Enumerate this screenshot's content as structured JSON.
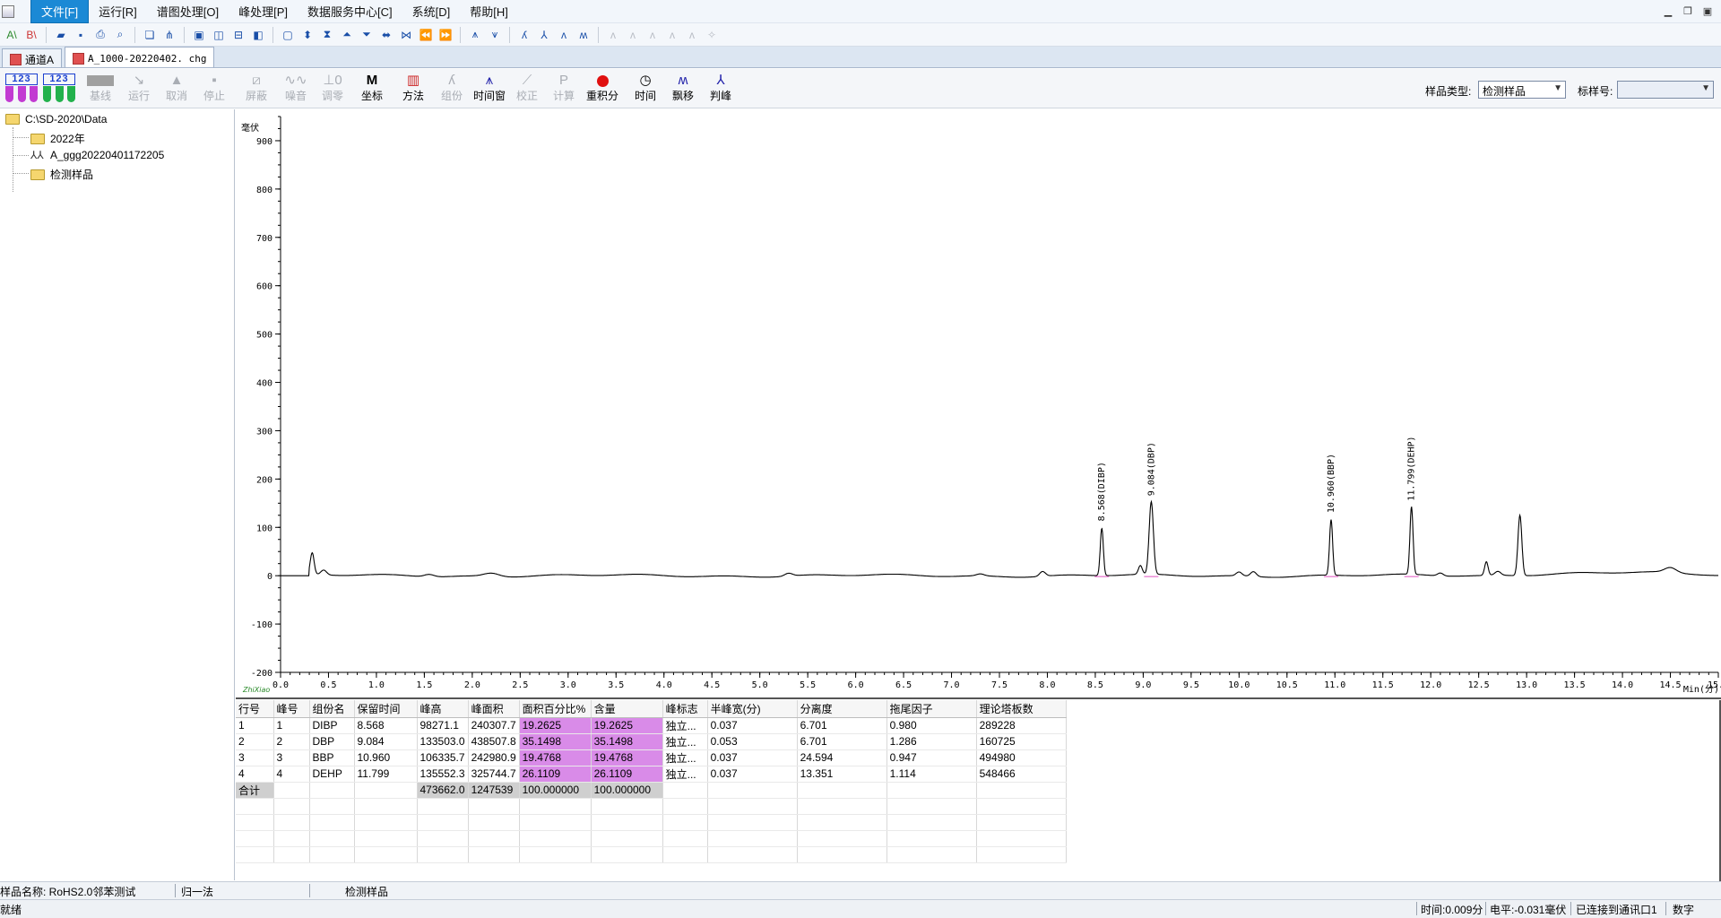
{
  "menu": {
    "items": [
      "文件[F]",
      "运行[R]",
      "谱图处理[O]",
      "峰处理[P]",
      "数据服务中心[C]",
      "系统[D]",
      "帮助[H]"
    ]
  },
  "tabs": [
    {
      "label": "通道A",
      "active": false
    },
    {
      "label": "A_1000-20220402. chg",
      "active": true
    }
  ],
  "toolbar2": {
    "tools": [
      {
        "label": "基线",
        "enabled": false
      },
      {
        "label": "运行",
        "enabled": false
      },
      {
        "label": "取消",
        "enabled": false
      },
      {
        "label": "停止",
        "enabled": false
      },
      {
        "label": "屏蔽",
        "enabled": false
      },
      {
        "label": "噪音",
        "enabled": false
      },
      {
        "label": "调零",
        "enabled": false
      },
      {
        "label": "坐标",
        "enabled": true
      },
      {
        "label": "方法",
        "enabled": true
      },
      {
        "label": "组份",
        "enabled": false
      },
      {
        "label": "时间窗",
        "enabled": true
      },
      {
        "label": "校正",
        "enabled": false
      },
      {
        "label": "计算",
        "enabled": false
      },
      {
        "label": "重积分",
        "enabled": true
      },
      {
        "label": "时间",
        "enabled": true
      },
      {
        "label": "飘移",
        "enabled": true
      },
      {
        "label": "判峰",
        "enabled": true
      }
    ],
    "sample_type_label": "样品类型:",
    "sample_type_value": "检测样品",
    "std_no_label": "标样号:",
    "std_no_value": "",
    "vial_digits": "123"
  },
  "tree": {
    "root": "C:\\SD-2020\\Data",
    "children": [
      "2022年",
      "A_ggg20220401172205",
      "检测样品"
    ]
  },
  "chart_data": {
    "type": "line",
    "ylabel": "毫伏",
    "xlabel": "Min(分)",
    "xlim": [
      0.0,
      15.0
    ],
    "ylim": [
      -200,
      950
    ],
    "x_ticks": [
      "0.0",
      "0.5",
      "1.0",
      "1.5",
      "2.0",
      "2.5",
      "3.0",
      "3.5",
      "4.0",
      "4.5",
      "5.0",
      "5.5",
      "6.0",
      "6.5",
      "7.0",
      "7.5",
      "8.0",
      "8.5",
      "9.0",
      "9.5",
      "10.0",
      "10.5",
      "11.0",
      "11.5",
      "12.0",
      "12.5",
      "13.0",
      "13.5",
      "14.0",
      "14.5",
      "15.0"
    ],
    "y_ticks": [
      "900",
      "800",
      "700",
      "600",
      "500",
      "400",
      "300",
      "200",
      "100",
      "0",
      "-100",
      "-200"
    ],
    "peak_labels": [
      {
        "x": 8.568,
        "text": "8.568(DIBP)"
      },
      {
        "x": 9.084,
        "text": "9.084(DBP)"
      },
      {
        "x": 10.96,
        "text": "10.960(BBP)"
      },
      {
        "x": 11.799,
        "text": "11.799(DEHP)"
      }
    ],
    "peaks": [
      {
        "x": 0.33,
        "h": 45,
        "w": 0.02
      },
      {
        "x": 0.45,
        "h": 10,
        "w": 0.03
      },
      {
        "x": 1.55,
        "h": 5,
        "w": 0.05
      },
      {
        "x": 2.2,
        "h": 7,
        "w": 0.08
      },
      {
        "x": 5.3,
        "h": 6,
        "w": 0.04
      },
      {
        "x": 7.3,
        "h": 4,
        "w": 0.04
      },
      {
        "x": 7.95,
        "h": 10,
        "w": 0.03
      },
      {
        "x": 8.568,
        "h": 98,
        "w": 0.016
      },
      {
        "x": 8.97,
        "h": 18,
        "w": 0.02
      },
      {
        "x": 9.084,
        "h": 150,
        "w": 0.022
      },
      {
        "x": 10.0,
        "h": 8,
        "w": 0.03
      },
      {
        "x": 10.15,
        "h": 10,
        "w": 0.03
      },
      {
        "x": 10.96,
        "h": 115,
        "w": 0.016
      },
      {
        "x": 11.799,
        "h": 140,
        "w": 0.016
      },
      {
        "x": 12.1,
        "h": 6,
        "w": 0.03
      },
      {
        "x": 12.58,
        "h": 28,
        "w": 0.018
      },
      {
        "x": 12.7,
        "h": 8,
        "w": 0.03
      },
      {
        "x": 12.93,
        "h": 125,
        "w": 0.02
      },
      {
        "x": 14.5,
        "h": 10,
        "w": 0.06
      }
    ],
    "logo_text": "ZhiXiao",
    "legend": "none",
    "grid": false
  },
  "table": {
    "headers": [
      "行号",
      "峰号",
      "组份名",
      "保留时间",
      "峰高",
      "峰面积",
      "面积百分比%",
      "含量",
      "峰标志",
      "半峰宽(分)",
      "分离度",
      "拖尾因子",
      "理论塔板数"
    ],
    "rows": [
      [
        "1",
        "1",
        "DIBP",
        "8.568",
        "98271.1",
        "240307.7",
        "19.2625",
        "19.2625",
        "独立...",
        "0.037",
        "6.701",
        "0.980",
        "289228"
      ],
      [
        "2",
        "2",
        "DBP",
        "9.084",
        "133503.0",
        "438507.8",
        "35.1498",
        "35.1498",
        "独立...",
        "0.053",
        "6.701",
        "1.286",
        "160725"
      ],
      [
        "3",
        "3",
        "BBP",
        "10.960",
        "106335.7",
        "242980.9",
        "19.4768",
        "19.4768",
        "独立...",
        "0.037",
        "24.594",
        "0.947",
        "494980"
      ],
      [
        "4",
        "4",
        "DEHP",
        "11.799",
        "135552.3",
        "325744.7",
        "26.1109",
        "26.1109",
        "独立...",
        "0.037",
        "13.351",
        "1.114",
        "548466"
      ]
    ],
    "total": [
      "合计",
      "",
      "",
      "",
      "473662.0",
      "1247539",
      "100.000000",
      "100.000000",
      "",
      "",
      "",
      "",
      ""
    ]
  },
  "status1": {
    "sample_name": "样品名称: RoHS2.0邻苯测试",
    "method": "归一法",
    "sample_kind": "检测样品"
  },
  "status2": {
    "ready": "就绪",
    "time": "时间:0.009分",
    "level": "电平:-0.031毫伏",
    "port": "已连接到通讯口1",
    "mode": "数字"
  }
}
